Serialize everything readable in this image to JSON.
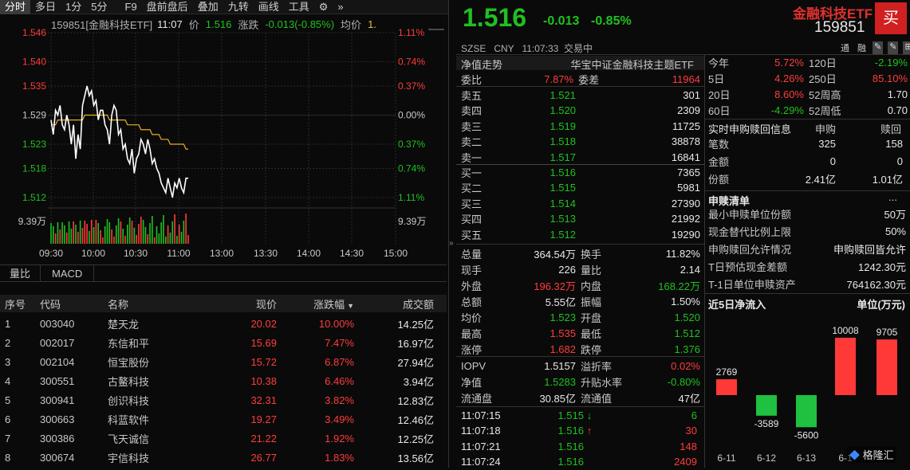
{
  "toolbar": {
    "tabs": [
      "分时",
      "多日",
      "1分",
      "5分",
      "F9",
      "盘前盘后",
      "叠加",
      "九转",
      "画线",
      "工具"
    ],
    "gear": "⚙",
    "dbl": "»"
  },
  "chart_header": {
    "code_name": "159851[金融科技ETF]",
    "time": "11:07",
    "price_label": "价",
    "price": "1.516",
    "change_label": "涨跌",
    "change": "-0.013(-0.85%)",
    "avg_label": "均价",
    "avg": "1."
  },
  "chart_data": {
    "type": "line",
    "y_left_ticks": [
      "1.546",
      "1.540",
      "1.535",
      "1.529",
      "1.523",
      "1.518",
      "1.512"
    ],
    "y_right_ticks": [
      "1.11%",
      "0.74%",
      "0.37%",
      "0.00%",
      "0.37%",
      "0.74%",
      "1.11%"
    ],
    "volume_ticks": [
      "9.39万",
      "9.39万"
    ],
    "x_ticks": [
      "09:30",
      "10:00",
      "10:30",
      "11:00",
      "13:00",
      "13:30",
      "14:00",
      "14:30",
      "15:00"
    ],
    "prev_close": 1.529,
    "price": [
      1.528,
      1.525,
      1.53,
      1.529,
      1.531,
      1.527,
      1.526,
      1.529,
      1.527,
      1.523,
      1.527,
      1.52,
      1.525,
      1.522,
      1.531,
      1.533,
      1.535,
      1.533,
      1.534,
      1.531,
      1.532,
      1.528,
      1.53,
      1.53,
      1.527,
      1.526,
      1.523,
      1.529,
      1.531,
      1.53,
      1.525,
      1.526,
      1.522,
      1.523,
      1.52,
      1.519,
      1.522,
      1.517,
      1.52,
      1.521,
      1.524,
      1.523,
      1.521,
      1.524,
      1.522,
      1.519,
      1.52,
      1.518,
      1.517,
      1.515,
      1.514,
      1.513,
      1.516,
      1.514,
      1.512,
      1.515,
      1.514,
      1.516,
      1.514,
      1.513,
      1.516,
      1.516
    ],
    "avg": [
      1.527,
      1.527,
      1.527,
      1.528,
      1.528,
      1.528,
      1.528,
      1.528,
      1.528,
      1.528,
      1.528,
      1.528,
      1.528,
      1.528,
      1.528,
      1.529,
      1.529,
      1.529,
      1.529,
      1.529,
      1.529,
      1.529,
      1.529,
      1.529,
      1.529,
      1.529,
      1.528,
      1.528,
      1.528,
      1.528,
      1.528,
      1.528,
      1.528,
      1.528,
      1.527,
      1.527,
      1.527,
      1.527,
      1.527,
      1.527,
      1.526,
      1.526,
      1.526,
      1.526,
      1.526,
      1.525,
      1.525,
      1.525,
      1.525,
      1.524,
      1.524,
      1.524,
      1.524,
      1.523,
      1.523,
      1.523,
      1.523,
      1.523,
      1.523,
      1.523,
      1.522,
      1.522
    ],
    "ylim": [
      1.512,
      1.546
    ]
  },
  "sub_tabs": [
    "量比",
    "MACD"
  ],
  "table": {
    "headers": [
      "序号",
      "代码",
      "名称",
      "现价",
      "涨跌幅",
      "成交额"
    ],
    "rows": [
      [
        "1",
        "003040",
        "楚天龙",
        "20.02",
        "10.00%",
        "14.25亿"
      ],
      [
        "2",
        "002017",
        "东信和平",
        "15.69",
        "7.47%",
        "16.97亿"
      ],
      [
        "3",
        "002104",
        "恒宝股份",
        "15.72",
        "6.87%",
        "27.94亿"
      ],
      [
        "4",
        "300551",
        "古鳌科技",
        "10.38",
        "6.46%",
        "3.94亿"
      ],
      [
        "5",
        "300941",
        "创识科技",
        "32.31",
        "3.82%",
        "12.83亿"
      ],
      [
        "6",
        "300663",
        "科蓝软件",
        "19.27",
        "3.49%",
        "12.46亿"
      ],
      [
        "7",
        "300386",
        "飞天诚信",
        "21.22",
        "1.92%",
        "12.25亿"
      ],
      [
        "8",
        "300674",
        "宇信科技",
        "26.77",
        "1.83%",
        "13.56亿"
      ]
    ]
  },
  "quote": {
    "price": "1.516",
    "change": "-0.013",
    "pct": "-0.85%",
    "name": "金融科技ETF",
    "code": "159851",
    "buy": "买",
    "market_line": "SZSE   CNY   11:07:33  交易中",
    "nav_label": "净值走势",
    "nav_name": "华宝中证金融科技主题ETF",
    "weibi_label": "委比",
    "weibi": "7.87%",
    "weicha_label": "委差",
    "weicha": "11964",
    "asks": [
      [
        "卖五",
        "1.521",
        "301"
      ],
      [
        "卖四",
        "1.520",
        "2309"
      ],
      [
        "卖三",
        "1.519",
        "11725"
      ],
      [
        "卖二",
        "1.518",
        "38878"
      ],
      [
        "卖一",
        "1.517",
        "16841"
      ]
    ],
    "bids": [
      [
        "买一",
        "1.516",
        "7365"
      ],
      [
        "买二",
        "1.515",
        "5981"
      ],
      [
        "买三",
        "1.514",
        "27390"
      ],
      [
        "买四",
        "1.513",
        "21992"
      ],
      [
        "买五",
        "1.512",
        "19290"
      ]
    ],
    "stats": [
      [
        "总量",
        "364.54万",
        "换手",
        "11.82%"
      ],
      [
        "现手",
        "226",
        "量比",
        "2.14"
      ],
      [
        "外盘",
        "196.32万",
        "内盘",
        "168.22万"
      ],
      [
        "总额",
        "5.55亿",
        "振幅",
        "1.50%"
      ],
      [
        "均价",
        "1.523",
        "开盘",
        "1.520"
      ],
      [
        "最高",
        "1.535",
        "最低",
        "1.512"
      ],
      [
        "涨停",
        "1.682",
        "跌停",
        "1.376"
      ]
    ],
    "iopv": [
      [
        "IOPV",
        "1.5157",
        "溢折率",
        "0.02%"
      ],
      [
        "净值",
        "1.5283",
        "升贴水率",
        "-0.80%"
      ],
      [
        "流通盘",
        "30.85亿",
        "流通值",
        "47亿"
      ]
    ],
    "ticks": [
      [
        "11:07:15",
        "1.515",
        "↓",
        "6"
      ],
      [
        "11:07:18",
        "1.516",
        "↑",
        "30"
      ],
      [
        "11:07:21",
        "1.516",
        "",
        "148"
      ],
      [
        "11:07:24",
        "1.516",
        "",
        "2409"
      ]
    ]
  },
  "right": {
    "icons_row": [
      "通",
      "融",
      "✎",
      "✎",
      "⊞"
    ],
    "perf": [
      [
        "今年",
        "5.72%",
        "120日",
        "-2.19%"
      ],
      [
        "5日",
        "4.26%",
        "250日",
        "85.10%"
      ],
      [
        "20日",
        "8.60%",
        "52周高",
        "1.70"
      ],
      [
        "60日",
        "-4.29%",
        "52周低",
        "0.70"
      ]
    ],
    "redeem_title": "实时申购赎回信息",
    "redeem_h1": "申购",
    "redeem_h2": "赎回",
    "redeem": [
      [
        "笔数",
        "325",
        "158"
      ],
      [
        "金额",
        "0",
        "0"
      ],
      [
        "份额",
        "2.41亿",
        "1.01亿"
      ]
    ],
    "list_title": "申赎清单",
    "more": "...",
    "list": [
      [
        "最小申赎单位份额",
        "50万"
      ],
      [
        "现金替代比例上限",
        "50%"
      ],
      [
        "申购赎回允许情况",
        "申购赎回皆允许"
      ],
      [
        "T日预估现金差额",
        "1242.30元"
      ],
      [
        "T-1日单位申赎资产",
        "764162.30元"
      ]
    ],
    "flow_title": "近5日净流入",
    "flow_unit": "单位(万元)",
    "flow_chart": {
      "type": "bar",
      "categories": [
        "6-11",
        "6-12",
        "6-13",
        "6-1"
      ],
      "values": [
        2769,
        -3589,
        -5600,
        10008,
        9705
      ],
      "labels": [
        "2769",
        "-3589",
        "-5600",
        "10008",
        "9705"
      ]
    },
    "watermark": "格隆汇"
  }
}
